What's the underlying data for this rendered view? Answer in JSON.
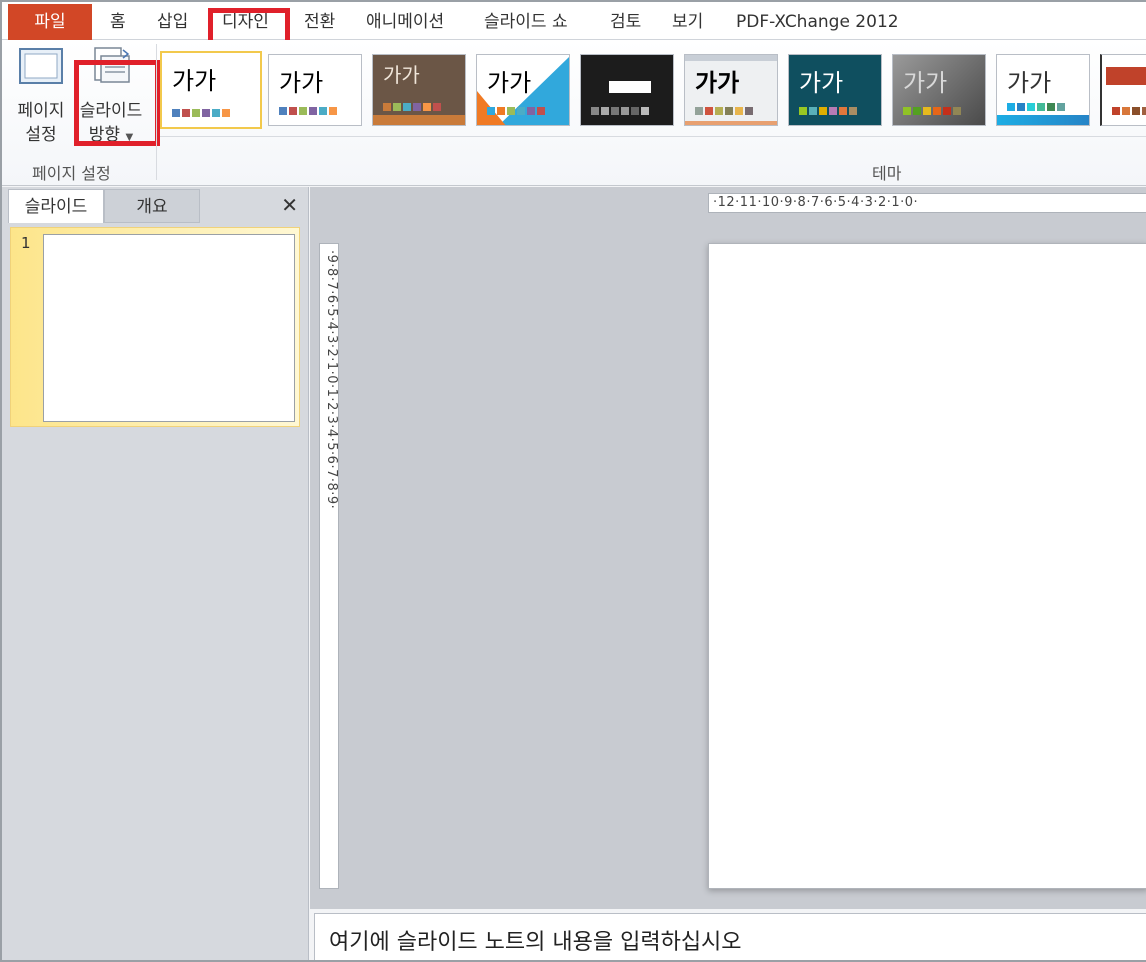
{
  "ribbon_tabs": {
    "file": "파일",
    "home": "홈",
    "insert": "삽입",
    "design": "디자인",
    "transitions": "전환",
    "animations": "애니메이션",
    "slideshow": "슬라이드 쇼",
    "review": "검토",
    "view": "보기",
    "pdf": "PDF-XChange 2012"
  },
  "page_setup_group": {
    "page_setup_line1": "페이지",
    "page_setup_line2": "설정",
    "orientation_line1": "슬라이드",
    "orientation_line2": "방향",
    "label": "페이지 설정"
  },
  "themes_group": {
    "label": "테마",
    "sample_text": "가가",
    "themes": [
      {
        "name": "office",
        "bg": "#ffffff",
        "fg": "#000000",
        "swatches": [
          "#4f81bd",
          "#c0504d",
          "#9bbb59",
          "#8064a2",
          "#4bacc6",
          "#f79646"
        ]
      },
      {
        "name": "adjacency",
        "bg": "#ffffff",
        "fg": "#000000",
        "swatches": [
          "#4f81bd",
          "#c0504d",
          "#9bbb59",
          "#8064a2",
          "#4bacc6",
          "#f79646"
        ]
      },
      {
        "name": "angles",
        "bg": "#6b5646",
        "fg": "#f0e6da",
        "swatches": [
          "#c97b3a",
          "#9bbb59",
          "#4bacc6",
          "#8064a2",
          "#f79646",
          "#c0504d"
        ]
      },
      {
        "name": "apex",
        "bg": "#ffffff",
        "fg": "#000000",
        "swatches": [
          "#31a8dc",
          "#f07a24",
          "#9bbb59",
          "#4bacc6",
          "#8064a2",
          "#c0504d"
        ]
      },
      {
        "name": "black-tie",
        "bg": "#1c1c1c",
        "fg": "#ffffff",
        "swatches": [
          "#888888",
          "#aaaaaa",
          "#777777",
          "#999999",
          "#666666",
          "#bbbbbb"
        ]
      },
      {
        "name": "clarity",
        "bg": "#eef0f2",
        "fg": "#000000",
        "swatches": [
          "#93a299",
          "#cf543f",
          "#b5ae53",
          "#848058",
          "#e8b54d",
          "#786c71"
        ]
      },
      {
        "name": "composite",
        "bg": "#0f4f5f",
        "fg": "#ffffff",
        "swatches": [
          "#98c723",
          "#59b0b9",
          "#deae00",
          "#b77bb4",
          "#e0773c",
          "#a98d63"
        ]
      },
      {
        "name": "concourse",
        "bg": "#6a6a6a",
        "fg": "#d0d0d0",
        "swatches": [
          "#90c226",
          "#54a021",
          "#e6b91e",
          "#e76618",
          "#c42f1a",
          "#918655"
        ]
      },
      {
        "name": "couture",
        "bg": "#ffffff",
        "fg": "#333333",
        "swatches": [
          "#1cade4",
          "#2683c6",
          "#27ced7",
          "#42ba97",
          "#3e8853",
          "#62a39f"
        ]
      },
      {
        "name": "elemental",
        "bg": "#ffffff",
        "fg": "#c0422a",
        "swatches": [
          "#c0422a",
          "#d8773a",
          "#8a4f2a",
          "#a06040",
          "#d09050",
          "#804030"
        ]
      }
    ]
  },
  "slide_panel": {
    "tab_slides": "슬라이드",
    "tab_outline": "개요",
    "close": "✕",
    "slide_number": "1"
  },
  "rulers": {
    "horizontal": "·12·11·10·9·8·7·6·5·4·3·2·1·0·",
    "vertical": "·9·8·7·6·5·4·3·2·1·0·1·2·3·4·5·6·7·8·9·"
  },
  "notes": {
    "placeholder": "여기에 슬라이드 노트의 내용을 입력하십시오"
  },
  "colors": {
    "file_tab": "#d24726",
    "highlight": "#e0202a",
    "selected_border": "#f2c94c"
  }
}
